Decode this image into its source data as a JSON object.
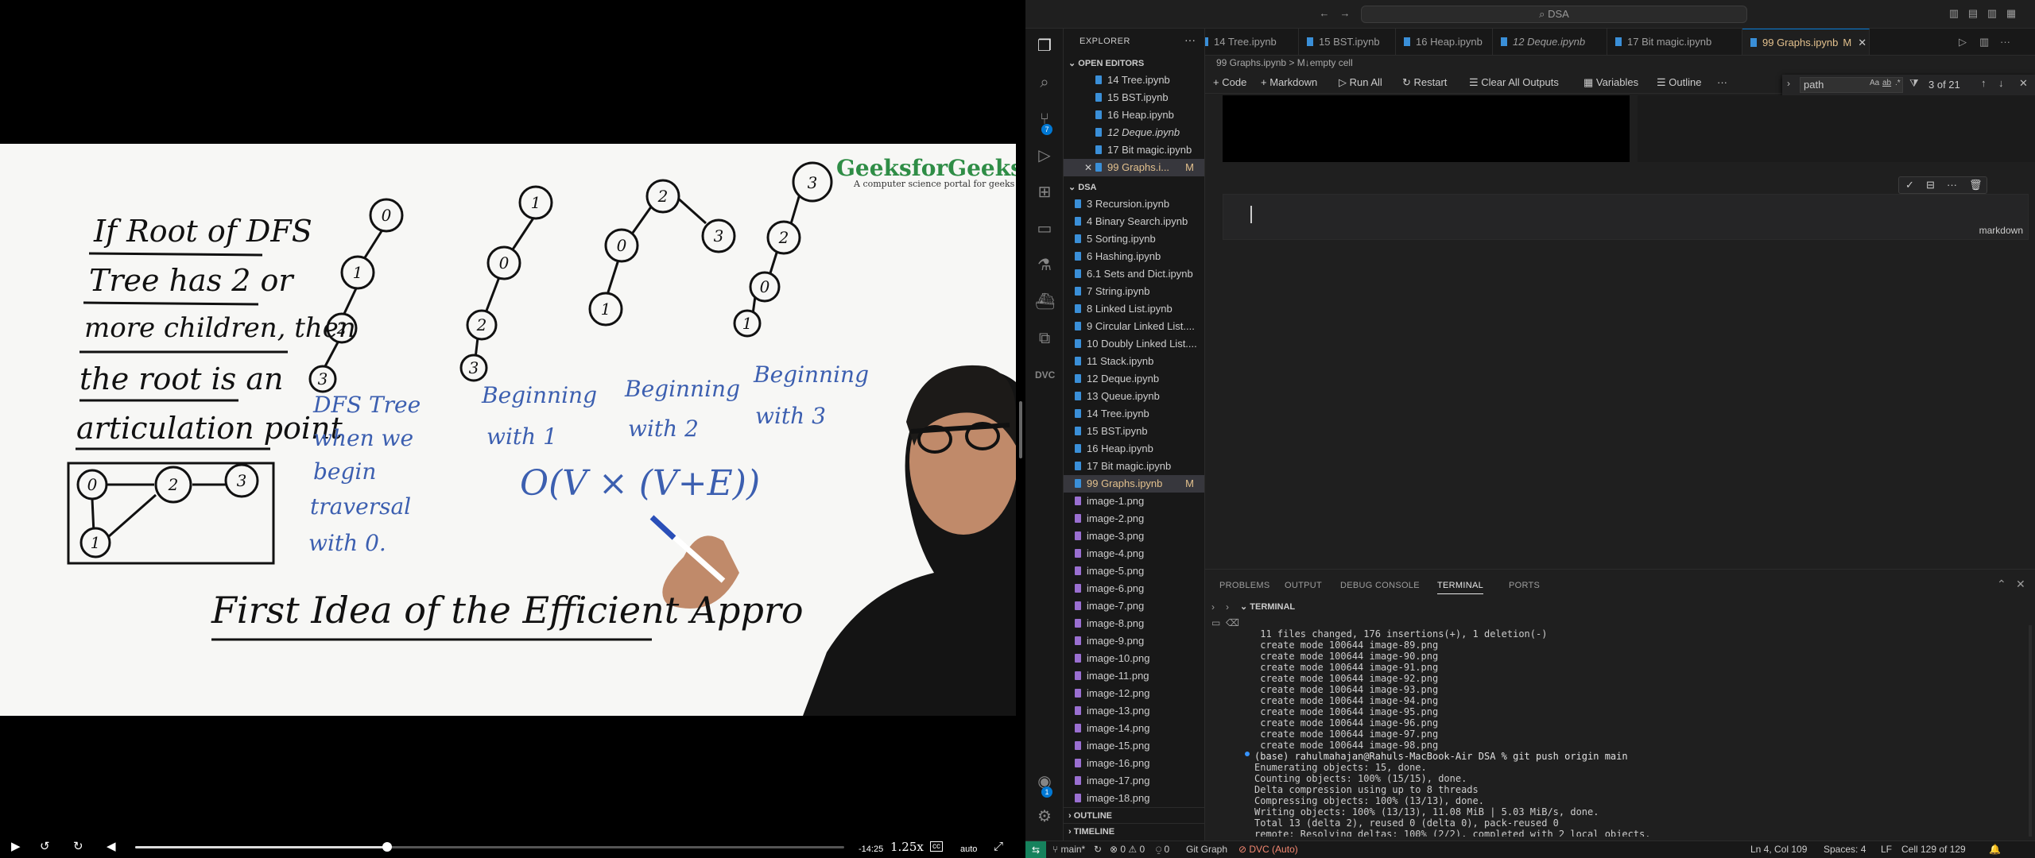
{
  "video": {
    "logo": "GeeksforGeeks",
    "logo_tagline": "A computer science portal for geeks",
    "whiteboard": {
      "rule_lines": [
        "If Root of DFS",
        "Tree has 2 or",
        "more children, then",
        "the root is an",
        "articulation point"
      ],
      "dfs_tree_caption": [
        "DFS Tree",
        "when we",
        "begin",
        "traversal",
        "with 0."
      ],
      "caption_1": [
        "Beginning",
        "with 1"
      ],
      "caption_2": [
        "Beginning",
        "with 2"
      ],
      "caption_3": [
        "Beginning",
        "with 3"
      ],
      "formula": "O(V × (V+E))",
      "heading": "First Idea of the Efficient Appro",
      "tree_nodes": {
        "tree0": [
          "0",
          "1",
          "2",
          "3"
        ],
        "tree1": [
          "1",
          "0",
          "2",
          "3"
        ],
        "tree2": [
          "2",
          "0",
          "3",
          "1"
        ],
        "tree3": [
          "3",
          "2",
          "0",
          "1"
        ],
        "graph": [
          "0",
          "2",
          "3",
          "1"
        ]
      }
    },
    "controls": {
      "time_remaining": "-14:25",
      "speed": "1.25x",
      "cc": "cc",
      "quality": "auto",
      "progress": 0.355
    }
  },
  "vscode": {
    "search_box": "DSA",
    "explorer_title": "EXPLORER",
    "open_editors_label": "OPEN EDITORS",
    "open_editors": [
      {
        "name": "14 Tree.ipynb",
        "italic": false,
        "modified": "",
        "selected": false
      },
      {
        "name": "15 BST.ipynb",
        "italic": false,
        "modified": "",
        "selected": false
      },
      {
        "name": "16 Heap.ipynb",
        "italic": false,
        "modified": "",
        "selected": false
      },
      {
        "name": "12 Deque.ipynb",
        "italic": true,
        "modified": "",
        "selected": false
      },
      {
        "name": "17 Bit magic.ipynb",
        "italic": false,
        "modified": "",
        "selected": false
      },
      {
        "name": "99 Graphs.i...",
        "italic": false,
        "modified": "M",
        "selected": true
      }
    ],
    "folder_label": "DSA",
    "files": [
      {
        "name": "3 Recursion.ipynb",
        "type": "nb",
        "modified": ""
      },
      {
        "name": "4 Binary Search.ipynb",
        "type": "nb",
        "modified": ""
      },
      {
        "name": "5 Sorting.ipynb",
        "type": "nb",
        "modified": ""
      },
      {
        "name": "6 Hashing.ipynb",
        "type": "nb",
        "modified": ""
      },
      {
        "name": "6.1 Sets and Dict.ipynb",
        "type": "nb",
        "modified": ""
      },
      {
        "name": "7 String.ipynb",
        "type": "nb",
        "modified": ""
      },
      {
        "name": "8 Linked List.ipynb",
        "type": "nb",
        "modified": ""
      },
      {
        "name": "9 Circular Linked List....",
        "type": "nb",
        "modified": ""
      },
      {
        "name": "10 Doubly Linked List....",
        "type": "nb",
        "modified": ""
      },
      {
        "name": "11 Stack.ipynb",
        "type": "nb",
        "modified": ""
      },
      {
        "name": "12 Deque.ipynb",
        "type": "nb",
        "modified": ""
      },
      {
        "name": "13 Queue.ipynb",
        "type": "nb",
        "modified": ""
      },
      {
        "name": "14 Tree.ipynb",
        "type": "nb",
        "modified": ""
      },
      {
        "name": "15 BST.ipynb",
        "type": "nb",
        "modified": ""
      },
      {
        "name": "16 Heap.ipynb",
        "type": "nb",
        "modified": ""
      },
      {
        "name": "17 Bit magic.ipynb",
        "type": "nb",
        "modified": ""
      },
      {
        "name": "99 Graphs.ipynb",
        "type": "nb",
        "modified": "M"
      },
      {
        "name": "image-1.png",
        "type": "png",
        "modified": ""
      },
      {
        "name": "image-2.png",
        "type": "png",
        "modified": ""
      },
      {
        "name": "image-3.png",
        "type": "png",
        "modified": ""
      },
      {
        "name": "image-4.png",
        "type": "png",
        "modified": ""
      },
      {
        "name": "image-5.png",
        "type": "png",
        "modified": ""
      },
      {
        "name": "image-6.png",
        "type": "png",
        "modified": ""
      },
      {
        "name": "image-7.png",
        "type": "png",
        "modified": ""
      },
      {
        "name": "image-8.png",
        "type": "png",
        "modified": ""
      },
      {
        "name": "image-9.png",
        "type": "png",
        "modified": ""
      },
      {
        "name": "image-10.png",
        "type": "png",
        "modified": ""
      },
      {
        "name": "image-11.png",
        "type": "png",
        "modified": ""
      },
      {
        "name": "image-12.png",
        "type": "png",
        "modified": ""
      },
      {
        "name": "image-13.png",
        "type": "png",
        "modified": ""
      },
      {
        "name": "image-14.png",
        "type": "png",
        "modified": ""
      },
      {
        "name": "image-15.png",
        "type": "png",
        "modified": ""
      },
      {
        "name": "image-16.png",
        "type": "png",
        "modified": ""
      },
      {
        "name": "image-17.png",
        "type": "png",
        "modified": ""
      },
      {
        "name": "image-18.png",
        "type": "png",
        "modified": ""
      }
    ],
    "outline_label": "OUTLINE",
    "timeline_label": "TIMELINE",
    "tabs": [
      {
        "name": "14 Tree.ipynb",
        "italic": false,
        "active": false
      },
      {
        "name": "15 BST.ipynb",
        "italic": false,
        "active": false
      },
      {
        "name": "16 Heap.ipynb",
        "italic": false,
        "active": false
      },
      {
        "name": "12 Deque.ipynb",
        "italic": true,
        "active": false
      },
      {
        "name": "17 Bit magic.ipynb",
        "italic": false,
        "active": false
      },
      {
        "name": "99 Graphs.ipynb",
        "italic": false,
        "active": true,
        "modified": "M"
      }
    ],
    "breadcrumb": "99 Graphs.ipynb > M↓empty cell",
    "toolbar": {
      "code": "Code",
      "markdown": "Markdown",
      "run_all": "Run All",
      "restart": "Restart",
      "clear_outputs": "Clear All Outputs",
      "variables": "Variables",
      "outline": "Outline",
      "more": "···"
    },
    "find": {
      "value": "path",
      "count": "3 of 21",
      "opt_case": "Aa",
      "opt_word": "ab",
      "opt_regex": ".*"
    },
    "cell": {
      "language": "markdown"
    },
    "panel": {
      "tabs": [
        "PROBLEMS",
        "OUTPUT",
        "DEBUG CONSOLE",
        "TERMINAL",
        "PORTS"
      ],
      "active_tab": "TERMINAL",
      "terminal_label": "TERMINAL"
    },
    "terminal_lines": [
      " 11 files changed, 176 insertions(+), 1 deletion(-)",
      " create mode 100644 image-89.png",
      " create mode 100644 image-90.png",
      " create mode 100644 image-91.png",
      " create mode 100644 image-92.png",
      " create mode 100644 image-93.png",
      " create mode 100644 image-94.png",
      " create mode 100644 image-95.png",
      " create mode 100644 image-96.png",
      " create mode 100644 image-97.png",
      " create mode 100644 image-98.png",
      "(base) rahulmahajan@Rahuls-MacBook-Air DSA % git push origin main",
      "Enumerating objects: 15, done.",
      "Counting objects: 100% (15/15), done.",
      "Delta compression using up to 8 threads",
      "Compressing objects: 100% (13/13), done.",
      "Writing objects: 100% (13/13), 11.08 MiB | 5.03 MiB/s, done.",
      "Total 13 (delta 2), reused 0 (delta 0), pack-reused 0",
      "remote: Resolving deltas: 100% (2/2), completed with 2 local objects."
    ],
    "status": {
      "branch": "main*",
      "errors": "0",
      "warnings": "0",
      "ports": "0",
      "git_graph": "Git Graph",
      "dvc": "DVC (Auto)",
      "position": "Ln 4, Col 109",
      "spaces": "Spaces: 4",
      "eol": "LF",
      "cell": "Cell 129 of 129"
    },
    "badges": {
      "source_control": "7",
      "accounts": "1"
    },
    "colors": {
      "accent": "#0078d4",
      "modified": "#e2c08d",
      "remote": "#16825d"
    }
  }
}
